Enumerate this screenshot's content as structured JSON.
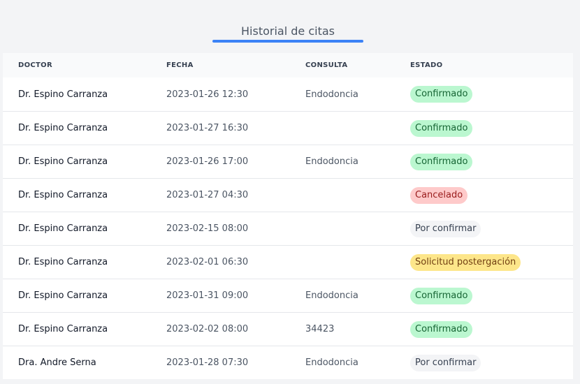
{
  "tab": {
    "title": "Historial de citas",
    "accent": "#3b82f6"
  },
  "table": {
    "headers": {
      "doctor": "DOCTOR",
      "fecha": "FECHA",
      "consulta": "CONSULTA",
      "estado": "ESTADO"
    },
    "rows": [
      {
        "doctor": "Dr. Espino Carranza",
        "fecha": "2023-01-26 12:30",
        "consulta": "Endodoncia",
        "estado": "Confirmado",
        "status_kind": "confirmado"
      },
      {
        "doctor": "Dr. Espino Carranza",
        "fecha": "2023-01-27 16:30",
        "consulta": "",
        "estado": "Confirmado",
        "status_kind": "confirmado"
      },
      {
        "doctor": "Dr. Espino Carranza",
        "fecha": "2023-01-26 17:00",
        "consulta": "Endodoncia",
        "estado": "Confirmado",
        "status_kind": "confirmado"
      },
      {
        "doctor": "Dr. Espino Carranza",
        "fecha": "2023-01-27 04:30",
        "consulta": "",
        "estado": "Cancelado",
        "status_kind": "cancelado"
      },
      {
        "doctor": "Dr. Espino Carranza",
        "fecha": "2023-02-15 08:00",
        "consulta": "",
        "estado": "Por confirmar",
        "status_kind": "pendiente"
      },
      {
        "doctor": "Dr. Espino Carranza",
        "fecha": "2023-02-01 06:30",
        "consulta": "",
        "estado": "Solicitud postergación",
        "status_kind": "postergacion"
      },
      {
        "doctor": "Dr. Espino Carranza",
        "fecha": "2023-01-31 09:00",
        "consulta": "Endodoncia",
        "estado": "Confirmado",
        "status_kind": "confirmado"
      },
      {
        "doctor": "Dr. Espino Carranza",
        "fecha": "2023-02-02 08:00",
        "consulta": "34423",
        "estado": "Confirmado",
        "status_kind": "confirmado"
      },
      {
        "doctor": "Dra. Andre Serna",
        "fecha": "2023-01-28 07:30",
        "consulta": "Endodoncia",
        "estado": "Por confirmar",
        "status_kind": "pendiente"
      }
    ]
  },
  "colors": {
    "confirmado": "#bbf7d0",
    "cancelado": "#fecaca",
    "pendiente": "#f3f4f6",
    "postergacion": "#fde68a"
  }
}
